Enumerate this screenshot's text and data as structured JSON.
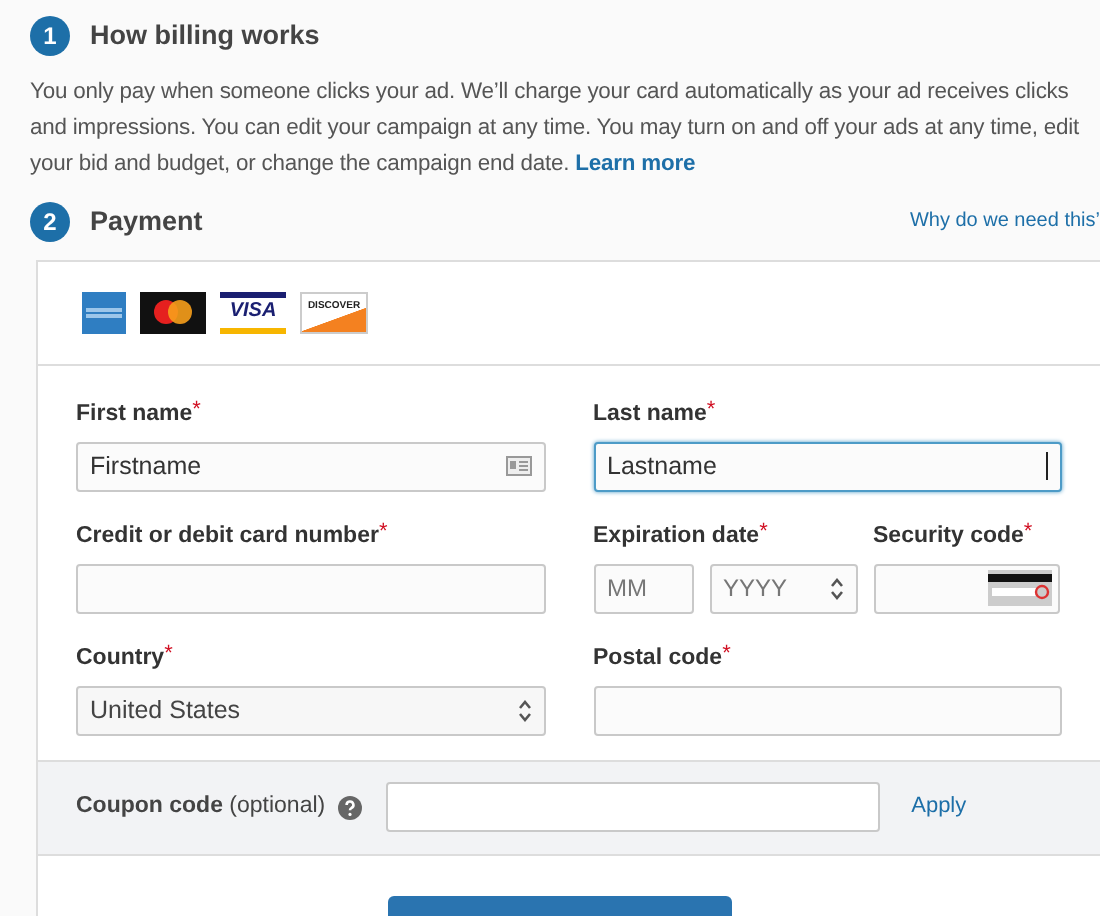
{
  "billing": {
    "step": "1",
    "title": "How billing works",
    "text": "You only pay when someone clicks your ad. We’ll charge your card automatically as your ad receives clicks and impressions. You can edit your campaign at any time. You may turn on and off your ads at any time, edit your bid and budget, or change the campaign end date.",
    "link": "Learn more"
  },
  "payment": {
    "step": "2",
    "title": "Payment",
    "help_link": "Why do we need this’",
    "cards": [
      {
        "kind": "amex"
      },
      {
        "kind": "mastercard"
      },
      {
        "kind": "visa",
        "label": "VISA"
      },
      {
        "kind": "discover",
        "label": "DISCOVER"
      }
    ],
    "rows": [
      [
        {
          "kind": "contact_text",
          "label": "First name",
          "marker": "*",
          "value": "Firstname",
          "focused": false
        },
        {
          "kind": "text",
          "label": "Last name",
          "marker": "*",
          "value": "Lastname",
          "focused": true
        }
      ],
      [
        {
          "kind": "text",
          "label": "Credit or debit card number",
          "marker": "*",
          "focused": false
        },
        {
          "kind": "expiry",
          "label": "Expiration date",
          "marker": "*",
          "month_placeholder": "MM",
          "year": "YYYY"
        },
        {
          "kind": "cvc",
          "label": "Security code",
          "marker": "*"
        }
      ],
      [
        {
          "kind": "select",
          "label": "Country",
          "marker": "*",
          "value": "United States"
        },
        {
          "kind": "text",
          "label": "Postal code",
          "marker": "*",
          "focused": false
        }
      ]
    ],
    "coupon": {
      "label": "**Coupon code** (optional)",
      "action": "Apply"
    }
  }
}
